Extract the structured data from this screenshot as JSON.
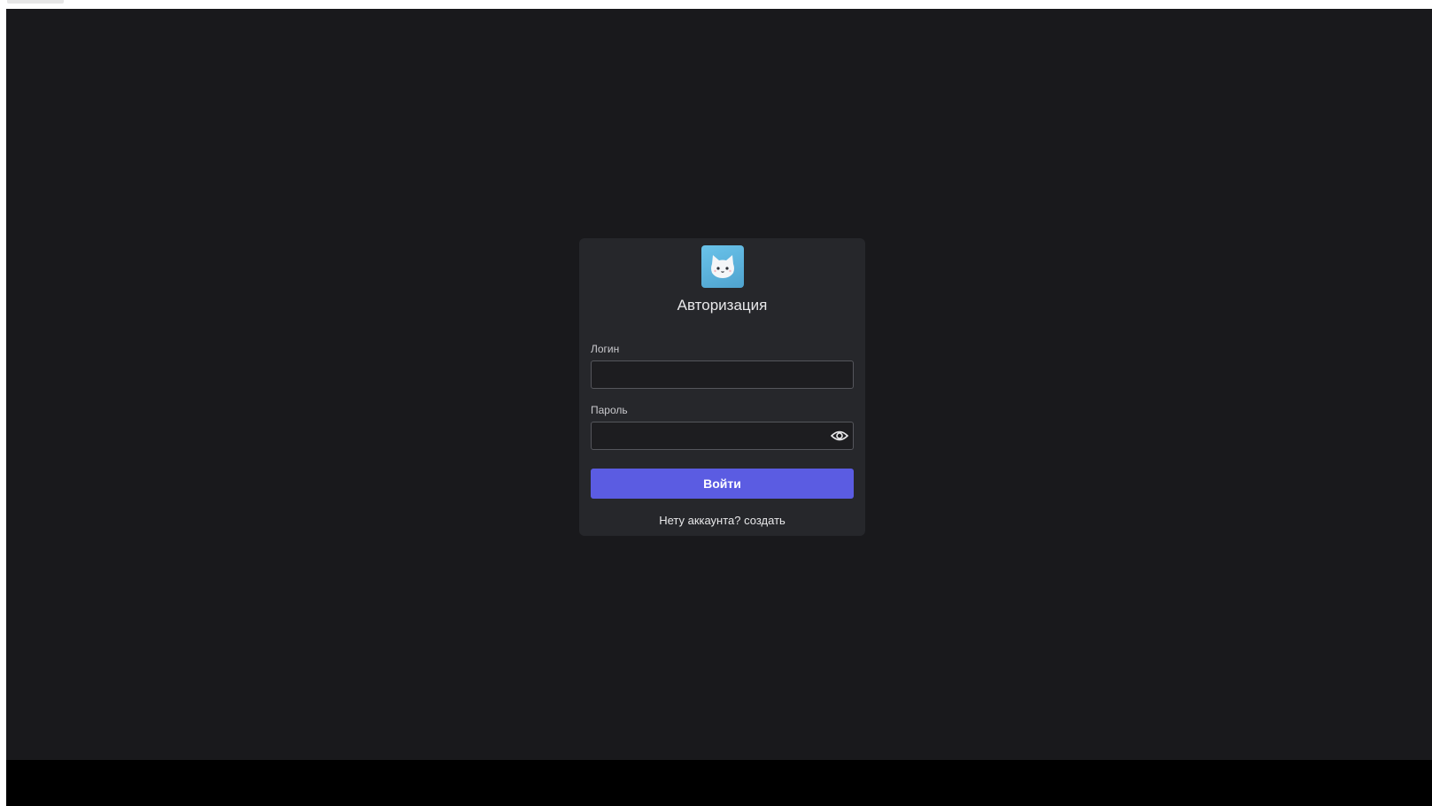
{
  "auth": {
    "title": "Авторизация",
    "login_label": "Логин",
    "login_value": "",
    "password_label": "Пароль",
    "password_value": "",
    "submit_label": "Войти",
    "no_account_text": "Нету аккаунта?",
    "create_link": "создать"
  },
  "icons": {
    "logo": "cat-logo-icon",
    "password_toggle": "eye-icon"
  },
  "colors": {
    "background": "#19191c",
    "card": "#26272b",
    "accent": "#5b5ce2",
    "logo_bg": "#5fb6e0"
  }
}
